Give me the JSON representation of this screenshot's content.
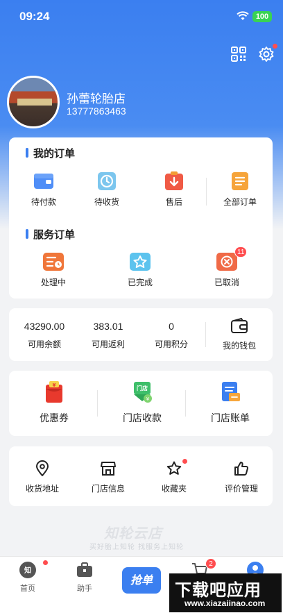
{
  "status_bar": {
    "time": "09:24",
    "battery": "100"
  },
  "profile": {
    "store_name": "孙蕾轮胎店",
    "phone": "13777863463"
  },
  "my_orders": {
    "title": "我的订单",
    "items": [
      {
        "label": "待付款",
        "icon": "wallet-icon"
      },
      {
        "label": "待收货",
        "icon": "clock-icon"
      },
      {
        "label": "售后",
        "icon": "return-icon"
      },
      {
        "label": "全部订单",
        "icon": "order-list-icon"
      }
    ]
  },
  "service_orders": {
    "title": "服务订单",
    "items": [
      {
        "label": "处理中",
        "icon": "processing-icon"
      },
      {
        "label": "已完成",
        "icon": "completed-star-icon"
      },
      {
        "label": "已取消",
        "icon": "cancelled-icon",
        "badge": "11"
      }
    ]
  },
  "finance": {
    "stats": [
      {
        "value": "43290.00",
        "label": "可用余额"
      },
      {
        "value": "383.01",
        "label": "可用返利"
      },
      {
        "value": "0",
        "label": "可用积分"
      }
    ],
    "wallet_label": "我的钱包"
  },
  "tools": {
    "items": [
      {
        "label": "优惠券",
        "icon": "coupon-icon"
      },
      {
        "label": "门店收款",
        "icon": "store-payment-icon",
        "icon_text": "门店"
      },
      {
        "label": "门店账单",
        "icon": "store-bill-icon"
      }
    ]
  },
  "more": {
    "items": [
      {
        "label": "收货地址",
        "icon": "location-pin-icon"
      },
      {
        "label": "门店信息",
        "icon": "storefront-icon"
      },
      {
        "label": "收藏夹",
        "icon": "star-icon"
      },
      {
        "label": "评价管理",
        "icon": "thumbs-up-icon"
      }
    ]
  },
  "watermark": {
    "logo": "知轮云店",
    "slogan": "买好胎上知轮  找服务上知轮"
  },
  "tabbar": {
    "items": [
      {
        "label": "首页",
        "icon": "home-logo-icon"
      },
      {
        "label": "助手",
        "icon": "briefcase-icon"
      },
      {
        "label": "抢单",
        "icon": "grab-order-button"
      },
      {
        "label": "",
        "icon": "cart-icon",
        "badge": "2"
      },
      {
        "label": "",
        "icon": "profile-icon"
      }
    ]
  },
  "download_banner": {
    "title": "下载吧应用",
    "url": "www.xiazaiinao.com"
  },
  "colors": {
    "primary": "#3b7ff0",
    "badge": "#ff4d4f",
    "background": "#f2f3f5"
  }
}
